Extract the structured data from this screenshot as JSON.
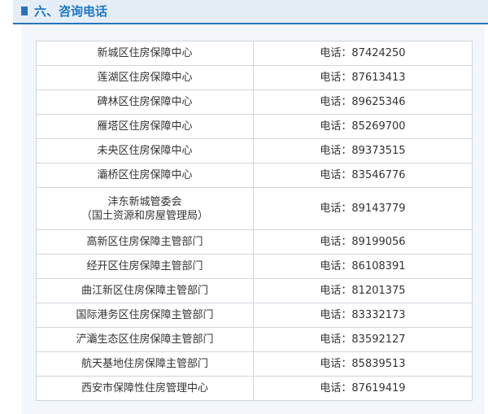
{
  "section": {
    "title": "六、咨询电话"
  },
  "contacts": [
    {
      "name": "新城区住房保障中心",
      "phone": "电话：87424250"
    },
    {
      "name": "莲湖区住房保障中心",
      "phone": "电话：87613413"
    },
    {
      "name": "碑林区住房保障中心",
      "phone": "电话：89625346"
    },
    {
      "name": "雁塔区住房保障中心",
      "phone": "电话：85269700"
    },
    {
      "name": "未央区住房保障中心",
      "phone": "电话：89373515"
    },
    {
      "name": "灞桥区住房保障中心",
      "phone": "电话：83546776"
    },
    {
      "name": "沣东新城管委会",
      "name_line2": "（国土资源和房屋管理局）",
      "phone": "电话：89143779"
    },
    {
      "name": "高新区住房保障主管部门",
      "phone": "电话：89199056"
    },
    {
      "name": "经开区住房保障主管部门",
      "phone": "电话：86108391"
    },
    {
      "name": "曲江新区住房保障主管部门",
      "phone": "电话：81201375"
    },
    {
      "name": "国际港务区住房保障主管部门",
      "phone": "电话：83332173"
    },
    {
      "name": "浐灞生态区住房保障主管部门",
      "phone": "电话：83592127"
    },
    {
      "name": "航天基地住房保障主管部门",
      "phone": "电话：85839513"
    },
    {
      "name": "西安市保障性住房管理中心",
      "phone": "电话：87619419"
    }
  ]
}
